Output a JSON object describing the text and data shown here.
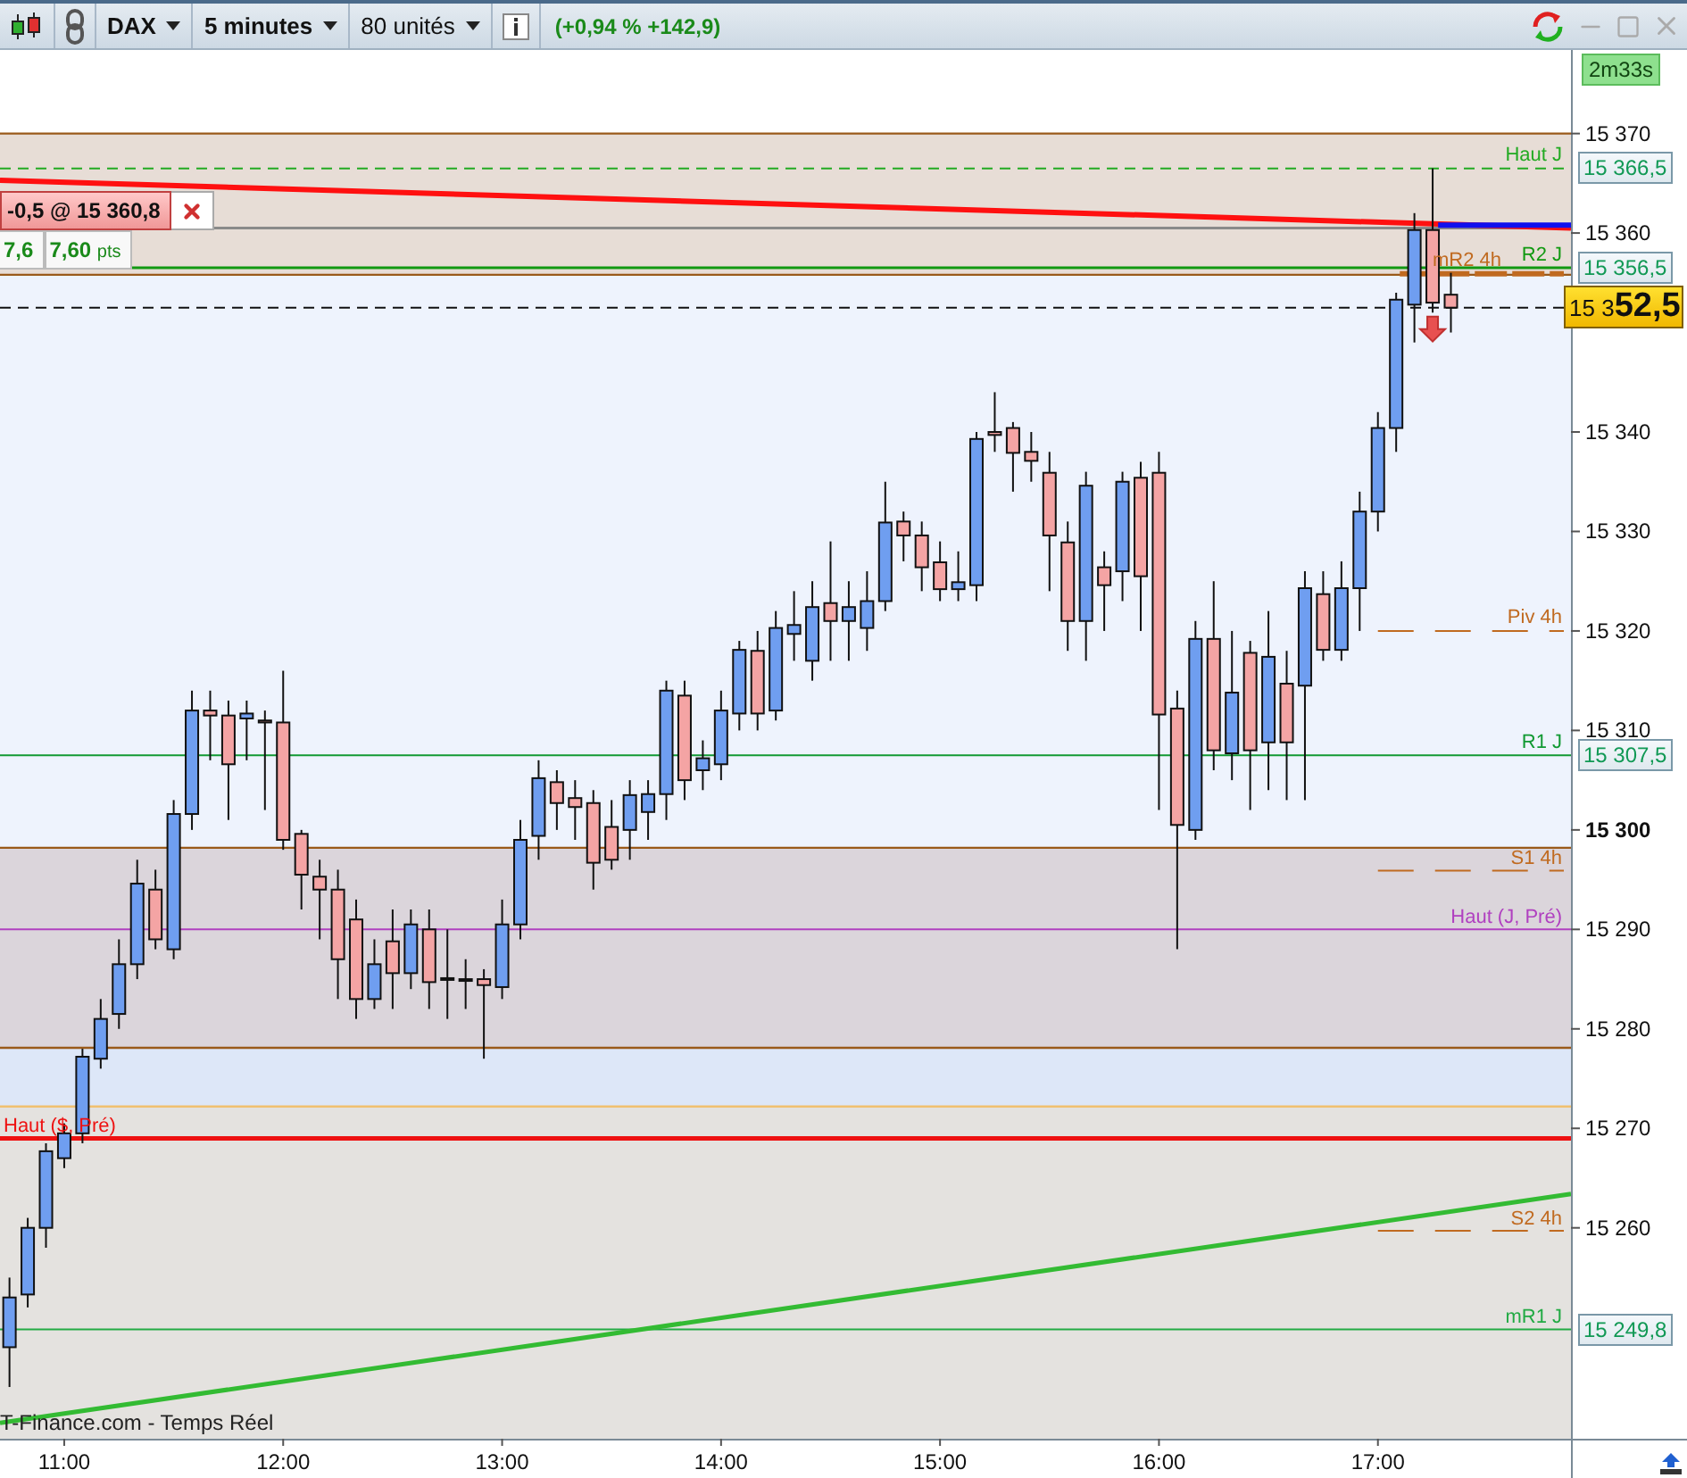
{
  "toolbar": {
    "instrument": "DAX",
    "period": "5 minutes",
    "units": "80 unités",
    "change": "(+0,94 % +142,9)"
  },
  "timer": "2m33s",
  "position": {
    "order": "-0,5 @ 15 360,8",
    "gain": "7,6",
    "points": "7,60",
    "unit": "pts"
  },
  "price_tag": {
    "prefix": "15 3",
    "main": "52,5"
  },
  "axis_tags": [
    "15 366,5",
    "15 356,5",
    "15 307,5",
    "15 249,8"
  ],
  "source": "T-Finance.com - Temps Réel",
  "chart_data": {
    "type": "candlestick",
    "xlim": [
      642.4,
      1104.7
    ],
    "ylim": [
      15238.8,
      15378.4
    ],
    "x": [
      645,
      650,
      655,
      660,
      665,
      670,
      675,
      680,
      685,
      690,
      695,
      700,
      705,
      710,
      715,
      720,
      725,
      730,
      735,
      740,
      745,
      750,
      755,
      760,
      765,
      770,
      775,
      780,
      785,
      790,
      795,
      800,
      805,
      810,
      815,
      820,
      825,
      830,
      835,
      840,
      845,
      850,
      855,
      860,
      865,
      870,
      875,
      880,
      885,
      890,
      895,
      900,
      905,
      910,
      915,
      920,
      925,
      930,
      935,
      940,
      945,
      950,
      955,
      960,
      965,
      970,
      975,
      980,
      985,
      990,
      995,
      1000,
      1005,
      1010,
      1015,
      1020,
      1025,
      1030,
      1035,
      1040
    ],
    "ohlc": [
      [
        15248,
        15255,
        15244,
        15253
      ],
      [
        15253.3,
        15261,
        15252,
        15260
      ],
      [
        15260,
        15268.5,
        15258,
        15267.7
      ],
      [
        15267,
        15270.5,
        15266,
        15269.5
      ],
      [
        15269.5,
        15278,
        15268.5,
        15277.2
      ],
      [
        15277,
        15283,
        15276,
        15281
      ],
      [
        15281.5,
        15289,
        15280,
        15286.5
      ],
      [
        15286.5,
        15297,
        15285,
        15294.6
      ],
      [
        15294,
        15296,
        15288,
        15289
      ],
      [
        15288,
        15303,
        15287,
        15301.6
      ],
      [
        15301.6,
        15314,
        15300,
        15312
      ],
      [
        15312,
        15314,
        15307,
        15311.5
      ],
      [
        15311.5,
        15313,
        15301,
        15306.6
      ],
      [
        15311.2,
        15313,
        15307,
        15311.7
      ],
      [
        15311,
        15312,
        15302,
        15310.8
      ],
      [
        15310.8,
        15316,
        15298,
        15299
      ],
      [
        15299.6,
        15300,
        15292,
        15295.5
      ],
      [
        15295.3,
        15297,
        15289,
        15294
      ],
      [
        15294,
        15296,
        15283,
        15287
      ],
      [
        15291,
        15293,
        15281,
        15283
      ],
      [
        15283,
        15289,
        15282,
        15286.5
      ],
      [
        15288.8,
        15292,
        15282,
        15285.6
      ],
      [
        15285.6,
        15292,
        15284,
        15290.5
      ],
      [
        15290,
        15292,
        15282,
        15284.7
      ],
      [
        15285,
        15290,
        15281,
        15285.1
      ],
      [
        15285,
        15287,
        15282,
        15284.9
      ],
      [
        15285,
        15286,
        15277,
        15284.4
      ],
      [
        15284.2,
        15293,
        15283,
        15290.5
      ],
      [
        15290.5,
        15301,
        15289,
        15299
      ],
      [
        15299.4,
        15307,
        15297,
        15305.2
      ],
      [
        15304.8,
        15306,
        15300,
        15302.7
      ],
      [
        15303.2,
        15305,
        15299,
        15302.3
      ],
      [
        15302.7,
        15304,
        15294,
        15296.7
      ],
      [
        15300.3,
        15303,
        15296,
        15297
      ],
      [
        15300,
        15305,
        15297,
        15303.5
      ],
      [
        15301.8,
        15305,
        15299,
        15303.6
      ],
      [
        15303.6,
        15315,
        15301,
        15314
      ],
      [
        15313.5,
        15315,
        15303,
        15305
      ],
      [
        15306,
        15309,
        15304,
        15307.2
      ],
      [
        15306.6,
        15314,
        15305,
        15312
      ],
      [
        15311.7,
        15319,
        15310,
        15318.1
      ],
      [
        15318,
        15320,
        15310,
        15311.7
      ],
      [
        15312,
        15322,
        15311,
        15320.3
      ],
      [
        15319.7,
        15324,
        15317,
        15320.6
      ],
      [
        15317,
        15325,
        15315,
        15322.4
      ],
      [
        15322.8,
        15329,
        15317,
        15321
      ],
      [
        15321,
        15325,
        15317,
        15322.4
      ],
      [
        15320.3,
        15326,
        15318,
        15323
      ],
      [
        15323,
        15335,
        15322,
        15330.9
      ],
      [
        15331,
        15332,
        15327,
        15329.6
      ],
      [
        15329.6,
        15331,
        15324,
        15326.4
      ],
      [
        15326.9,
        15329,
        15323,
        15324.2
      ],
      [
        15324.2,
        15328,
        15323,
        15324.9
      ],
      [
        15324.6,
        15340,
        15323,
        15339.3
      ],
      [
        15340,
        15344,
        15338,
        15339.7
      ],
      [
        15340.4,
        15341,
        15334,
        15337.9
      ],
      [
        15338,
        15340,
        15335,
        15337.1
      ],
      [
        15335.9,
        15338,
        15324,
        15329.6
      ],
      [
        15328.9,
        15331,
        15318,
        15321
      ],
      [
        15321,
        15336,
        15317,
        15334.6
      ],
      [
        15326.4,
        15328,
        15320,
        15324.6
      ],
      [
        15326,
        15336,
        15323,
        15335
      ],
      [
        15335.4,
        15337,
        15320,
        15325.5
      ],
      [
        15335.9,
        15338,
        15302,
        15311.6
      ],
      [
        15312.2,
        15314,
        15288,
        15300.5
      ],
      [
        15300,
        15321,
        15299,
        15319.2
      ],
      [
        15319.2,
        15325,
        15306,
        15308
      ],
      [
        15307.7,
        15320,
        15305,
        15313.8
      ],
      [
        15317.8,
        15319,
        15302,
        15308
      ],
      [
        15308.8,
        15322,
        15304,
        15317.4
      ],
      [
        15314.7,
        15318,
        15303,
        15308.8
      ],
      [
        15314.5,
        15326,
        15303,
        15324.3
      ],
      [
        15323.7,
        15326,
        15317,
        15318.1
      ],
      [
        15318.1,
        15327,
        15317,
        15324.3
      ],
      [
        15324.3,
        15334,
        15320,
        15332
      ],
      [
        15332,
        15342,
        15330,
        15340.4
      ],
      [
        15340.4,
        15354,
        15338,
        15353.3
      ],
      [
        15352.8,
        15362,
        15349,
        15360.3
      ],
      [
        15360.3,
        15366.5,
        15352,
        15353
      ],
      [
        15353.8,
        15356,
        15350,
        15352.5
      ]
    ],
    "xticks": [
      {
        "value": 660,
        "label": "11:00"
      },
      {
        "value": 720,
        "label": "12:00"
      },
      {
        "value": 780,
        "label": "13:00"
      },
      {
        "value": 840,
        "label": "14:00"
      },
      {
        "value": 900,
        "label": "15:00"
      },
      {
        "value": 960,
        "label": "16:00"
      },
      {
        "value": 1020,
        "label": "17:00"
      }
    ],
    "yticks": [
      {
        "value": 15370,
        "label": "15 370"
      },
      {
        "value": 15360,
        "label": "15 360"
      },
      {
        "value": 15340,
        "label": "15 340"
      },
      {
        "value": 15330,
        "label": "15 330"
      },
      {
        "value": 15320,
        "label": "15 320"
      },
      {
        "value": 15310,
        "label": "15 310"
      },
      {
        "value": 15300,
        "label": "15 300"
      },
      {
        "value": 15290,
        "label": "15 290"
      },
      {
        "value": 15280,
        "label": "15 280"
      },
      {
        "value": 15270,
        "label": "15 270"
      },
      {
        "value": 15260,
        "label": "15 260"
      }
    ],
    "bands": [
      {
        "axis": "y",
        "from": 15355.8,
        "to": 15370,
        "color": "#e7ddd6"
      },
      {
        "axis": "y",
        "from": 15298.2,
        "to": 15355.8,
        "color": "#eef3fd"
      },
      {
        "axis": "y",
        "from": 15278.1,
        "to": 15298.2,
        "color": "#dbd5db"
      },
      {
        "axis": "y",
        "from": 15272.2,
        "to": 15278.1,
        "color": "#dde7f8"
      },
      {
        "axis": "y",
        "from": 15238.8,
        "to": 15272.2,
        "color": "#e4e2df"
      }
    ],
    "ref_lines": [
      {
        "axis": "y",
        "value": 15370,
        "color": "#9a5a1a"
      },
      {
        "axis": "y",
        "value": 15355.8,
        "color": "#9a5a1a"
      },
      {
        "axis": "y",
        "value": 15298.2,
        "color": "#9a5a1a"
      },
      {
        "axis": "y",
        "value": 15278.1,
        "color": "#9a5a1a"
      },
      {
        "axis": "y",
        "value": 15272.2,
        "color": "#f0c070"
      },
      {
        "axis": "y",
        "value": 15366.5,
        "color": "#22aa22",
        "label": "Haut J"
      },
      {
        "axis": "y",
        "value": 15360.5,
        "color": "#8a8a8a"
      },
      {
        "axis": "y",
        "value": 15356.5,
        "color": "#119911",
        "label": "R2 J"
      },
      {
        "axis": "y",
        "value": 15355.9,
        "color": "#c06a20",
        "label": "mR2 4h"
      },
      {
        "axis": "y",
        "value": 15320,
        "color": "#c06a20",
        "label": "Piv 4h"
      },
      {
        "axis": "y",
        "value": 15307.5,
        "color": "#119933",
        "label": "R1 J"
      },
      {
        "axis": "y",
        "value": 15295.9,
        "color": "#c06a20",
        "label": "S1 4h"
      },
      {
        "axis": "y",
        "value": 15290,
        "color": "#b040c0",
        "label": "Haut (J, Pré)"
      },
      {
        "axis": "y",
        "value": 15269,
        "color": "#ee1111",
        "label": "Haut ($, Pré)"
      },
      {
        "axis": "y",
        "value": 15259.7,
        "color": "#c06a20",
        "label": "S2 4h"
      },
      {
        "axis": "y",
        "value": 15249.8,
        "color": "#22aa44",
        "label": "mR1 J"
      },
      {
        "axis": "y",
        "value": 15352.5,
        "color": "#111111"
      }
    ]
  }
}
